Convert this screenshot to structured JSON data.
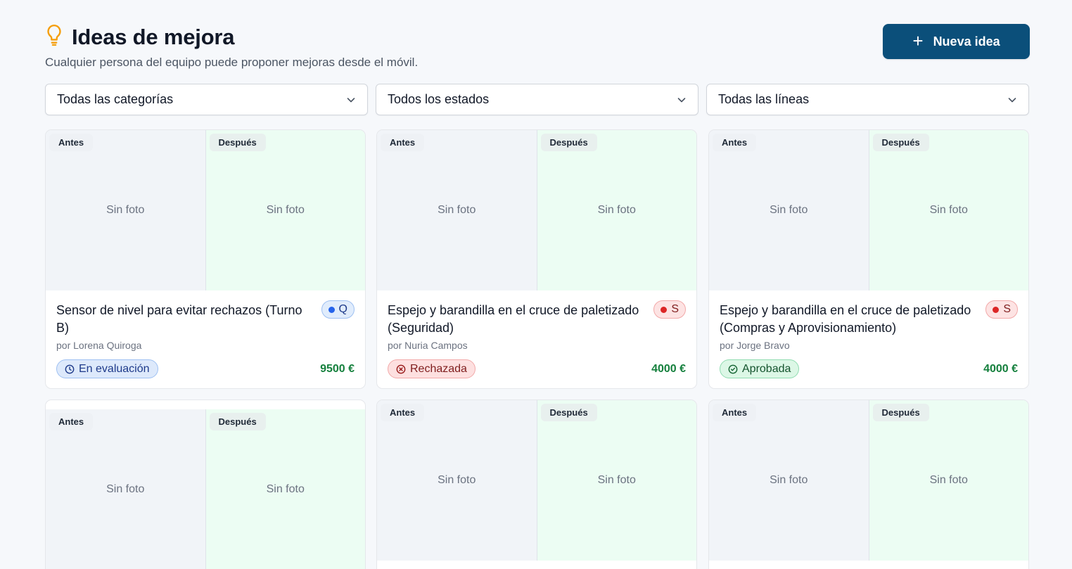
{
  "header": {
    "title": "Ideas de mejora",
    "subtitle": "Cualquier persona del equipo puede proponer mejoras desde el móvil.",
    "new_button_label": "Nueva idea",
    "accent_color": "#0b4f7a",
    "title_icon": "lightbulb-icon"
  },
  "filters": [
    {
      "label": "Todas las categorías"
    },
    {
      "label": "Todos los estados"
    },
    {
      "label": "Todas las líneas"
    }
  ],
  "photo_labels": {
    "before": "Antes",
    "after": "Después",
    "empty": "Sin foto"
  },
  "cards": [
    {
      "title": "Sensor de nivel para evitar rechazos (Turno B)",
      "category": "Q",
      "author": "por Lorena Quiroga",
      "status": "En evaluación",
      "amount": "9500 €"
    },
    {
      "title": "Espejo y barandilla en el cruce de paletizado (Seguridad)",
      "category": "S",
      "author": "por Nuria Campos",
      "status": "Rechazada",
      "amount": "4000 €"
    },
    {
      "title": "Espejo y barandilla en el cruce de paletizado (Compras y Aprovisionamiento)",
      "category": "S",
      "author": "por Jorge Bravo",
      "status": "Aprobada",
      "amount": "4000 €"
    }
  ]
}
